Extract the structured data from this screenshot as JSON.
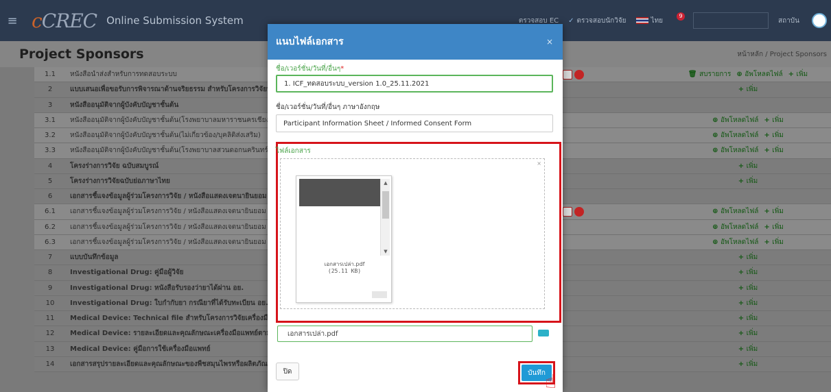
{
  "nav": {
    "brand_logo": "CREC",
    "brand_name": "Online Submission System",
    "links": [
      "ตรวจสอบ EC",
      "ตรวจสอบนักวิจัย"
    ],
    "lang": "ไทย",
    "notification_count": "9",
    "user": "สถาบัน"
  },
  "page": {
    "title": "Project Sponsors",
    "breadcrumb": "หน้าหลัก / Project Sponsors"
  },
  "rows": [
    {
      "num": "1.1",
      "name": "หนังสือนำส่งสำหรับการทดสอบระบบ",
      "group": false,
      "files": true,
      "actions": "list_upload_add"
    },
    {
      "num": "2",
      "name": "แบบเสนอเพื่อขอรับการพิจารณาด้านจริยธรรม สำหรับโครงการวิจัยทาง",
      "group": true,
      "files": false,
      "actions": "add"
    },
    {
      "num": "3",
      "name": "หนังสืออนุมัติจากผู้บังคับบัญชาชั้นต้น",
      "group": true,
      "files": false,
      "actions": "none"
    },
    {
      "num": "3.1",
      "name": "หนังสืออนุมัติจากผู้บังคับบัญชาชั้นต้น(โรงพยาบาลมหาราชนครเชียงใหม่)",
      "group": false,
      "files": false,
      "actions": "upload_add"
    },
    {
      "num": "3.2",
      "name": "หนังสืออนุมัติจากผู้บังคับบัญชาชั้นต้น(ไม่เกี่ยวข้อง/บุคลิติส่งเสริม)",
      "group": false,
      "files": false,
      "actions": "upload_add"
    },
    {
      "num": "3.3",
      "name": "หนังสืออนุมัติจากผู้บังคับบัญชาชั้นต้น(โรงพยาบาลสวนดอกนครินทร์)",
      "group": false,
      "files": false,
      "actions": "upload_add"
    },
    {
      "num": "4",
      "name": "โครงร่างการวิจัย ฉบับสมบูรณ์",
      "group": true,
      "files": false,
      "actions": "add"
    },
    {
      "num": "5",
      "name": "โครงร่างการวิจัยฉบับย่อภาษาไทย",
      "group": true,
      "files": false,
      "actions": "add"
    },
    {
      "num": "6",
      "name": "เอกสารชี้แจงข้อมูลผู้ร่วมโครงการวิจัย / หนังสือแสดงเจตนายินยอม",
      "group": true,
      "files": false,
      "actions": "none"
    },
    {
      "num": "6.1",
      "name": "เอกสารชี้แจงข้อมูลผู้ร่วมโครงการวิจัย / หนังสือแสดงเจตนายินยอม",
      "group": false,
      "files": true,
      "actions": "upload_add"
    },
    {
      "num": "6.2",
      "name": "เอกสารชี้แจงข้อมูลผู้ร่วมโครงการวิจัย / หนังสือแสดงเจตนายินยอม",
      "group": false,
      "files": false,
      "actions": "upload_add"
    },
    {
      "num": "6.3",
      "name": "เอกสารชี้แจงข้อมูลผู้ร่วมโครงการวิจัย / หนังสือแสดงเจตนายินยอม",
      "group": false,
      "files": false,
      "actions": "upload_add"
    },
    {
      "num": "7",
      "name": "แบบบันทึกข้อมูล",
      "group": true,
      "files": false,
      "actions": "add"
    },
    {
      "num": "8",
      "name": "Investigational Drug: คู่มือผู้วิจัย",
      "group": true,
      "files": false,
      "actions": "add"
    },
    {
      "num": "9",
      "name": "Investigational Drug: หนังสือรับรองว่ายาได้ผ่าน อย.",
      "group": true,
      "files": false,
      "actions": "add"
    },
    {
      "num": "10",
      "name": "Investigational Drug: ใบกำกับยา กรณียาที่ได้รับทะเบียน อย. แล้ว",
      "group": true,
      "files": false,
      "actions": "add"
    },
    {
      "num": "11",
      "name": "Medical Device: Technical file สำหรับโครงการวิจัยเครื่องมือแพทย์",
      "group": true,
      "files": false,
      "actions": "add"
    },
    {
      "num": "12",
      "name": "Medical Device: รายละเอียดและคุณลักษณะเครื่องมือแพทย์ตามที่ผู้ผลิต",
      "group": true,
      "files": false,
      "actions": "add"
    },
    {
      "num": "13",
      "name": "Medical Device: คู่มือการใช้เครื่องมือแพทย์",
      "group": true,
      "files": false,
      "actions": "add"
    },
    {
      "num": "14",
      "name": "เอกสารสรุปรายละเอียดและคุณลักษณะของพืชสมุนไพรหรือผลิตภัณฑ์",
      "group": true,
      "files": false,
      "actions": "add"
    }
  ],
  "actions_text": {
    "list": "สบรายการ",
    "upload": "อัพโหลดไฟล์",
    "add": "เพิ่ม"
  },
  "modal": {
    "title": "แนบไฟล์เอกสาร",
    "close_x": "×",
    "label_name": "ชื่อ/เวอร์ชั่น/วันที่/อื่นๆ",
    "required_mark": "*",
    "name_value": "1. ICF_ทดสอบระบบ_version 1.0_25.11.2021",
    "label_name_en": "ชื่อ/เวอร์ชั่น/วันที่/อื่นๆ ภาษาอังกฤษ",
    "name_en_value": "Participant Information Sheet / Informed Consent Form",
    "label_file": "ไฟล์เอกสาร",
    "preview_filename": "เอกสารเปล่า.pdf",
    "preview_size": "(25.11 KB)",
    "file_input_value": "เอกสารเปล่า.pdf",
    "btn_close": "ปิด",
    "btn_save": "บันทึก"
  },
  "colors": {
    "navbar": "#2c3a4f",
    "modal_header": "#3e86c6",
    "highlight": "#d6131a",
    "save_button": "#1f9ad6",
    "success_green": "#5ab55a"
  }
}
